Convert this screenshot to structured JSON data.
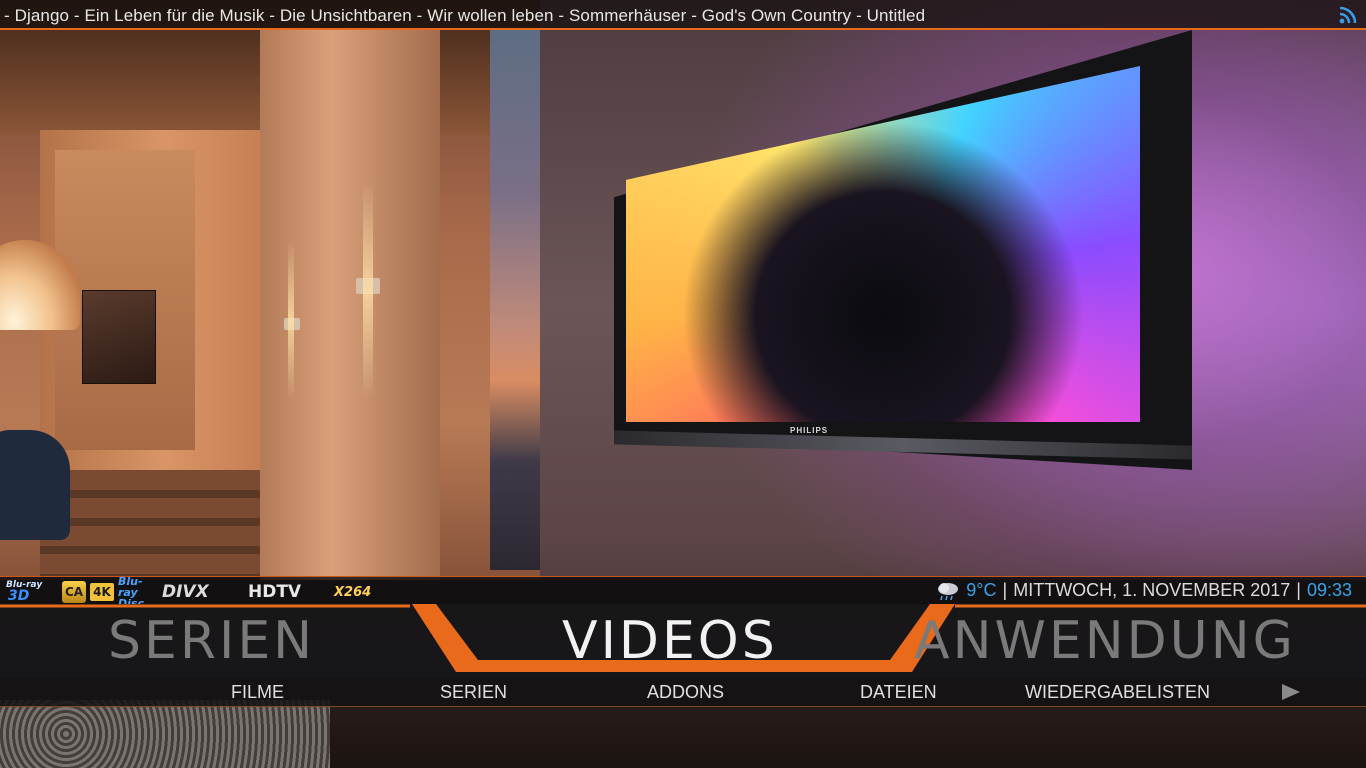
{
  "top_bar": {
    "ticker": "- Django - Ein Leben für die Musik - Die Unsichtbaren - Wir wollen leben - Sommerhäuser - God's Own Country - Untitled",
    "rss_icon": "rss-icon"
  },
  "background": {
    "tv_brand": "PHILIPS"
  },
  "info_bar": {
    "codec_flags": {
      "bluray_top": "Blu-ray",
      "bluray_3d": "3D",
      "ca": "CA",
      "k4": "4K",
      "bluray_disc": "Blu-ray Disc",
      "divx": "DIVX",
      "hdtv": "HDTV",
      "x264": "X264"
    },
    "weather_icon": "cloudy-rain-icon",
    "temperature": "9°C",
    "separator1": "|",
    "date": "MITTWOCH, 1. NOVEMBER 2017",
    "separator2": "|",
    "time": "09:33"
  },
  "main_menu": {
    "left": "SERIEN",
    "selected": "VIDEOS",
    "right": "ANWENDUNG"
  },
  "sub_menu": {
    "items": [
      "FILME",
      "SERIEN",
      "ADDONS",
      "DATEIEN",
      "WIEDERGABELISTEN"
    ],
    "next_icon": "play-arrow-icon"
  },
  "colors": {
    "accent": "#e86a1a",
    "info_blue": "#37a3e8",
    "selected_text": "#f2f2f2",
    "inactive_text": "#7a7a7a"
  }
}
